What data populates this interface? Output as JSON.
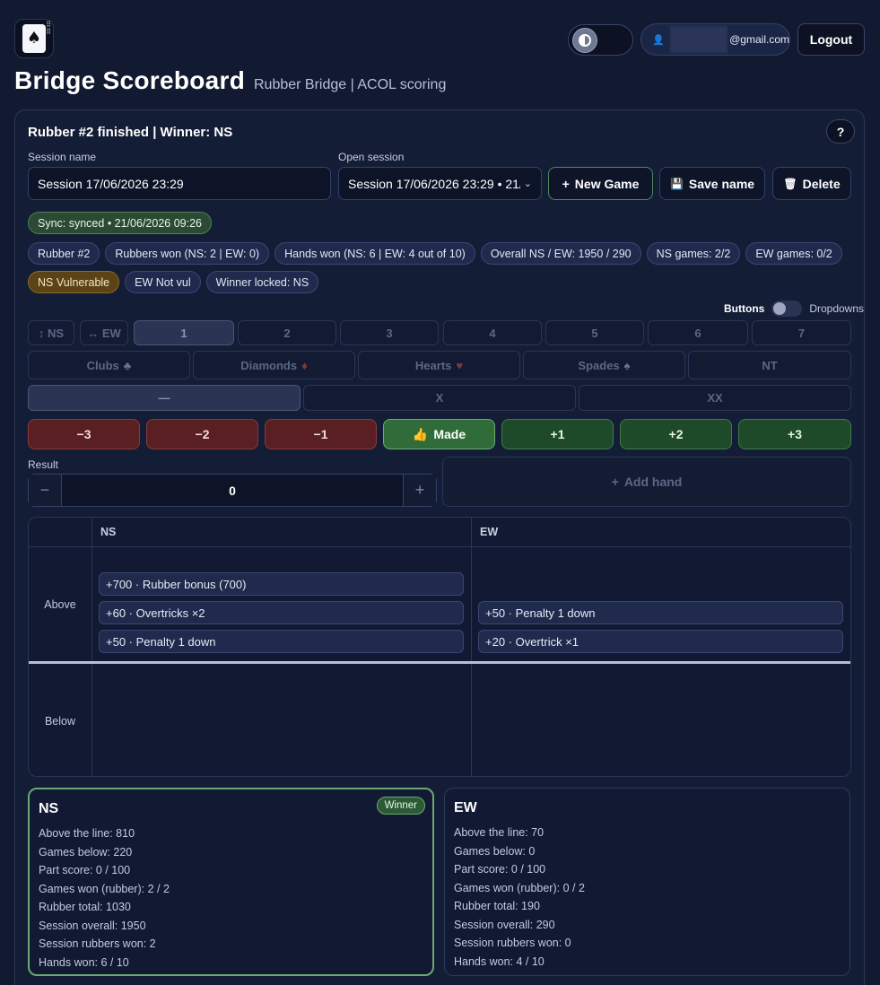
{
  "header": {
    "app_title": "Bridge Scoreboard",
    "subtitle": "Rubber Bridge | ACOL scoring",
    "user_email": "@gmail.com",
    "logout_label": "Logout"
  },
  "status": {
    "title": "Rubber #2 finished | Winner: NS",
    "help_label": "?"
  },
  "session": {
    "name_label": "Session name",
    "name_value": "Session 17/06/2026 23:29",
    "open_label": "Open session",
    "open_value": "Session 17/06/2026 23:29 • 21/",
    "new_game_label": "New Game",
    "save_name_label": "Save name",
    "delete_label": "Delete"
  },
  "sync_pill": "Sync: synced • 21/06/2026 09:26",
  "pills": [
    "Rubber #2",
    "Rubbers won (NS: 2 | EW: 0)",
    "Hands won (NS: 6 | EW: 4 out of 10)",
    "Overall NS / EW: 1950 / 290",
    "NS games: 2/2",
    "EW games: 0/2"
  ],
  "pills2": [
    "NS Vulnerable",
    "EW Not vul",
    "Winner locked: NS"
  ],
  "mode": {
    "buttons": "Buttons",
    "dropdowns": "Dropdowns"
  },
  "declarer": [
    "↕ NS",
    "↔ EW"
  ],
  "levels": [
    "1",
    "2",
    "3",
    "4",
    "5",
    "6",
    "7"
  ],
  "suits": [
    {
      "label": "Clubs",
      "glyph": "♣"
    },
    {
      "label": "Diamonds",
      "glyph": "♦"
    },
    {
      "label": "Hearts",
      "glyph": "♥"
    },
    {
      "label": "Spades",
      "glyph": "♠"
    },
    {
      "label": "NT",
      "glyph": ""
    }
  ],
  "doubling": [
    "—",
    "X",
    "XX"
  ],
  "results": [
    "−3",
    "−2",
    "−1",
    "Made",
    "+1",
    "+2",
    "+3"
  ],
  "result_label": "Result",
  "result_value": "0",
  "add_hand_label": "Add hand",
  "sheet": {
    "ns_header": "NS",
    "ew_header": "EW",
    "above_label": "Above",
    "below_label": "Below",
    "ns_above": [
      "+700 · Rubber bonus (700)",
      "+60 · Overtricks ×2",
      "+50 · Penalty 1 down"
    ],
    "ew_above": [
      "+50 · Penalty 1 down",
      "+20 · Overtrick ×1"
    ]
  },
  "summary": {
    "ns": {
      "title": "NS",
      "badge": "Winner",
      "lines": [
        "Above the line: 810",
        "Games below: 220",
        "Part score: 0 / 100",
        "Games won (rubber): 2 / 2",
        "Rubber total: 1030",
        "Session overall: 1950",
        "Session rubbers won: 2",
        "Hands won: 6 / 10"
      ]
    },
    "ew": {
      "title": "EW",
      "lines": [
        "Above the line: 70",
        "Games below: 0",
        "Part score: 0 / 100",
        "Games won (rubber): 0 / 2",
        "Rubber total: 190",
        "Session overall: 290",
        "Session rubbers won: 0",
        "Hands won: 4 / 10"
      ]
    }
  }
}
